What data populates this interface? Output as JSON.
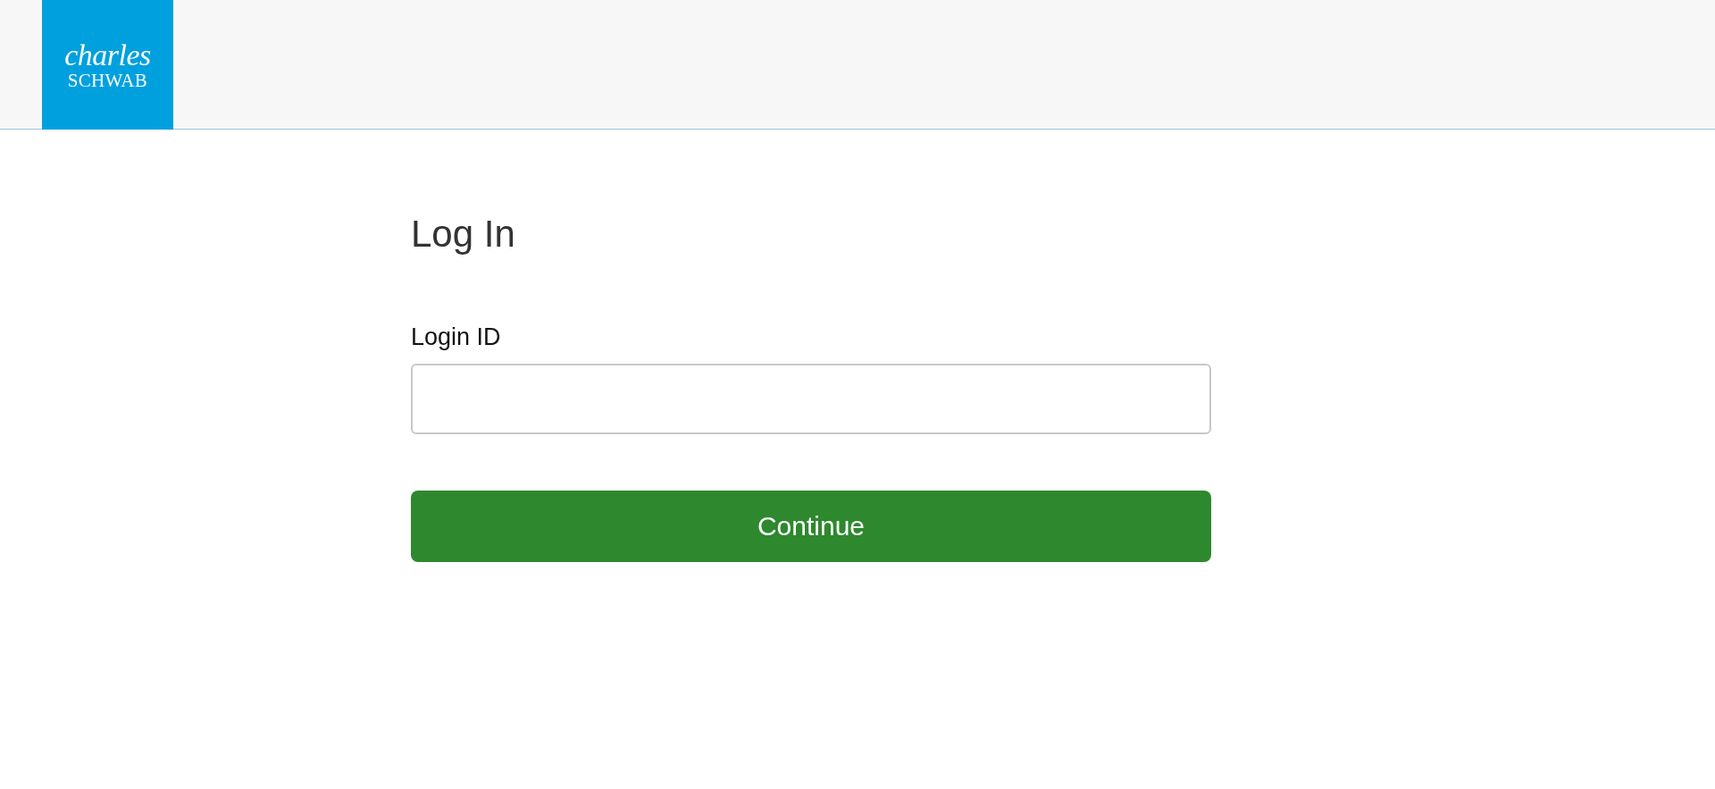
{
  "header": {
    "logo": {
      "line_1": "charles",
      "line_2": "SCHWAB"
    }
  },
  "form": {
    "title": "Log In",
    "field": {
      "label": "Login ID"
    },
    "button": "Continue"
  }
}
